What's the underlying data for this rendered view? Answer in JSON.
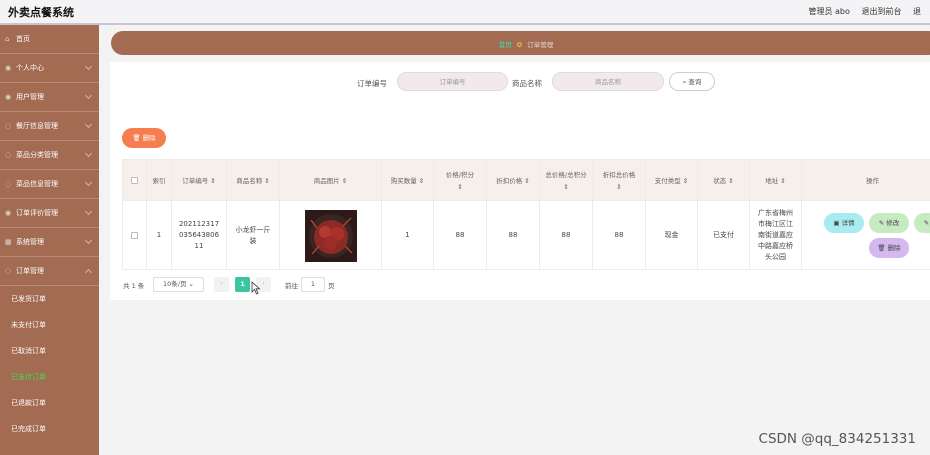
{
  "app": {
    "title": "外卖点餐系统"
  },
  "topbar": {
    "admin_label": "管理员 abo",
    "exit_front": "退出到前台",
    "logout": "退"
  },
  "sidebar": {
    "items": [
      {
        "label": "首页",
        "icon": "home-icon"
      },
      {
        "label": "个人中心",
        "icon": "user-icon"
      },
      {
        "label": "用户管理",
        "icon": "users-icon"
      },
      {
        "label": "餐厅信息管理",
        "icon": "shop-icon"
      },
      {
        "label": "菜品分类管理",
        "icon": "category-icon"
      },
      {
        "label": "菜品信息管理",
        "icon": "dish-icon"
      },
      {
        "label": "订单评价管理",
        "icon": "comment-icon"
      },
      {
        "label": "系统管理",
        "icon": "system-icon"
      },
      {
        "label": "订单管理",
        "icon": "order-icon"
      }
    ],
    "sub_items": [
      {
        "label": "已发货订单",
        "active": false
      },
      {
        "label": "未支付订单",
        "active": false
      },
      {
        "label": "已取消订单",
        "active": false
      },
      {
        "label": "已支付订单",
        "active": true
      },
      {
        "label": "已退款订单",
        "active": false
      },
      {
        "label": "已完成订单",
        "active": false
      }
    ]
  },
  "breadcrumb": {
    "home": "首页",
    "current": "订单管理"
  },
  "search": {
    "order_no_label": "订单编号",
    "order_no_placeholder": "订单编号",
    "goods_label": "商品名称",
    "goods_placeholder": "商品名称",
    "button": "查询"
  },
  "delete_label": "删除",
  "table": {
    "headers": [
      "索引",
      "订单编号",
      "商品名称",
      "商品图片",
      "购买数量",
      "价格/积分",
      "折扣价格",
      "总价格/总积分",
      "折扣总价格",
      "支付类型",
      "状态",
      "地址",
      "操作"
    ],
    "rows": [
      {
        "index": "1",
        "order_no": "20211231703564380611",
        "goods": "小龙虾一斤装",
        "qty": "1",
        "price": "88",
        "discount": "88",
        "total": "88",
        "discount_total": "88",
        "pay_type": "现金",
        "status": "已支付",
        "address": "广东省梅州市梅江区江南街道嘉应中路嘉应桥头公园"
      }
    ],
    "actions": {
      "detail": "详情",
      "edit": "修改",
      "ship": "发货",
      "delete": "删除"
    }
  },
  "pagination": {
    "total": "共 1 条",
    "page_size": "10条/页",
    "current": "1",
    "goto_label": "前往",
    "goto_value": "1",
    "page_suffix": "页"
  },
  "watermark": "CSDN @qq_834251331",
  "colors": {
    "sidebar": "#a26b52",
    "active_sub": "#3ee055",
    "delete_btn": "#f47e4f",
    "pager_active": "#3ec4a0"
  }
}
